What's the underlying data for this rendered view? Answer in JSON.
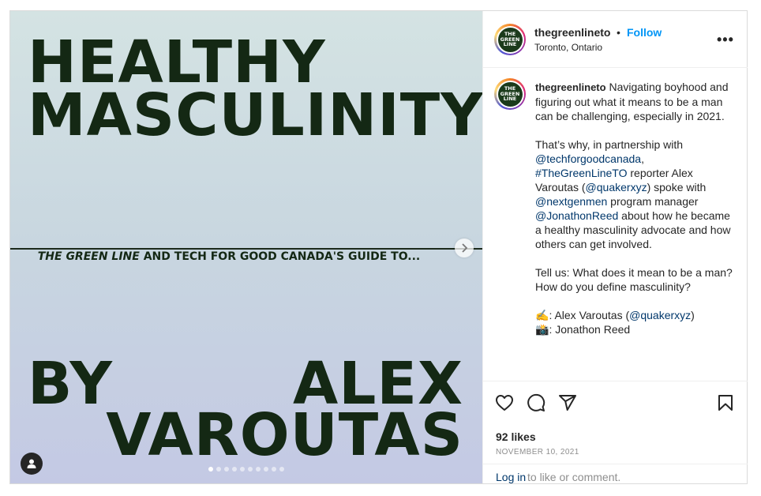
{
  "post": {
    "image": {
      "title_line1": "HEALTHY",
      "title_line2": "MASCULINITY",
      "guide_italic": "THE GREEN LINE",
      "guide_rest": " AND TECH FOR GOOD CANADA'S GUIDE TO...",
      "by": "BY",
      "author_first": "ALEX",
      "author_last": "VAROUTAS",
      "next_icon": "chevron-right-icon",
      "user_tag_icon": "user-icon",
      "carousel_total": 10,
      "carousel_active": 1
    },
    "header": {
      "username": "thegreenlineto",
      "separator": "•",
      "follow_label": "Follow",
      "location": "Toronto, Ontario",
      "more_label": "•••",
      "avatar_text": "THE GREEN LINE"
    },
    "caption": {
      "username": "thegreenlineto",
      "intro": " Navigating boyhood and figuring out what it means to be a man can be challenging, especially in 2021.",
      "p2_a": "That’s why, in partnership with ",
      "mention_tfg": "@techforgoodcanada",
      "p2_b": ",",
      "hashtag": "#TheGreenLineTO",
      "p2_c": " reporter Alex Varoutas (",
      "mention_quaker": "@quakerxyz",
      "p2_d": ") spoke with ",
      "mention_ngm": "@nextgenmen",
      "p2_e": " program manager ",
      "mention_jr": "@JonathonReed",
      "p2_f": " about how he became a healthy masculinity advocate and how others can get involved.",
      "p3": "Tell us: What does it mean to be a man? How do you define masculinity?",
      "writer_emoji": "✍️",
      "writer_a": ": Alex Varoutas (",
      "writer_mention": "@quakerxyz",
      "writer_b": ")",
      "photo_emoji": "📸",
      "photo_a": ": Jonathon Reed"
    },
    "actions": {
      "likes": "92 likes",
      "date": "NOVEMBER 10, 2021",
      "login_link": "Log in",
      "login_rest": " to like or comment.",
      "icons": [
        "heart-icon",
        "comment-icon",
        "share-icon",
        "bookmark-icon"
      ]
    }
  },
  "colors": {
    "accent": "#0095f6",
    "link": "#00376b",
    "muted": "#8e8e8e",
    "poster_text": "#142814"
  }
}
